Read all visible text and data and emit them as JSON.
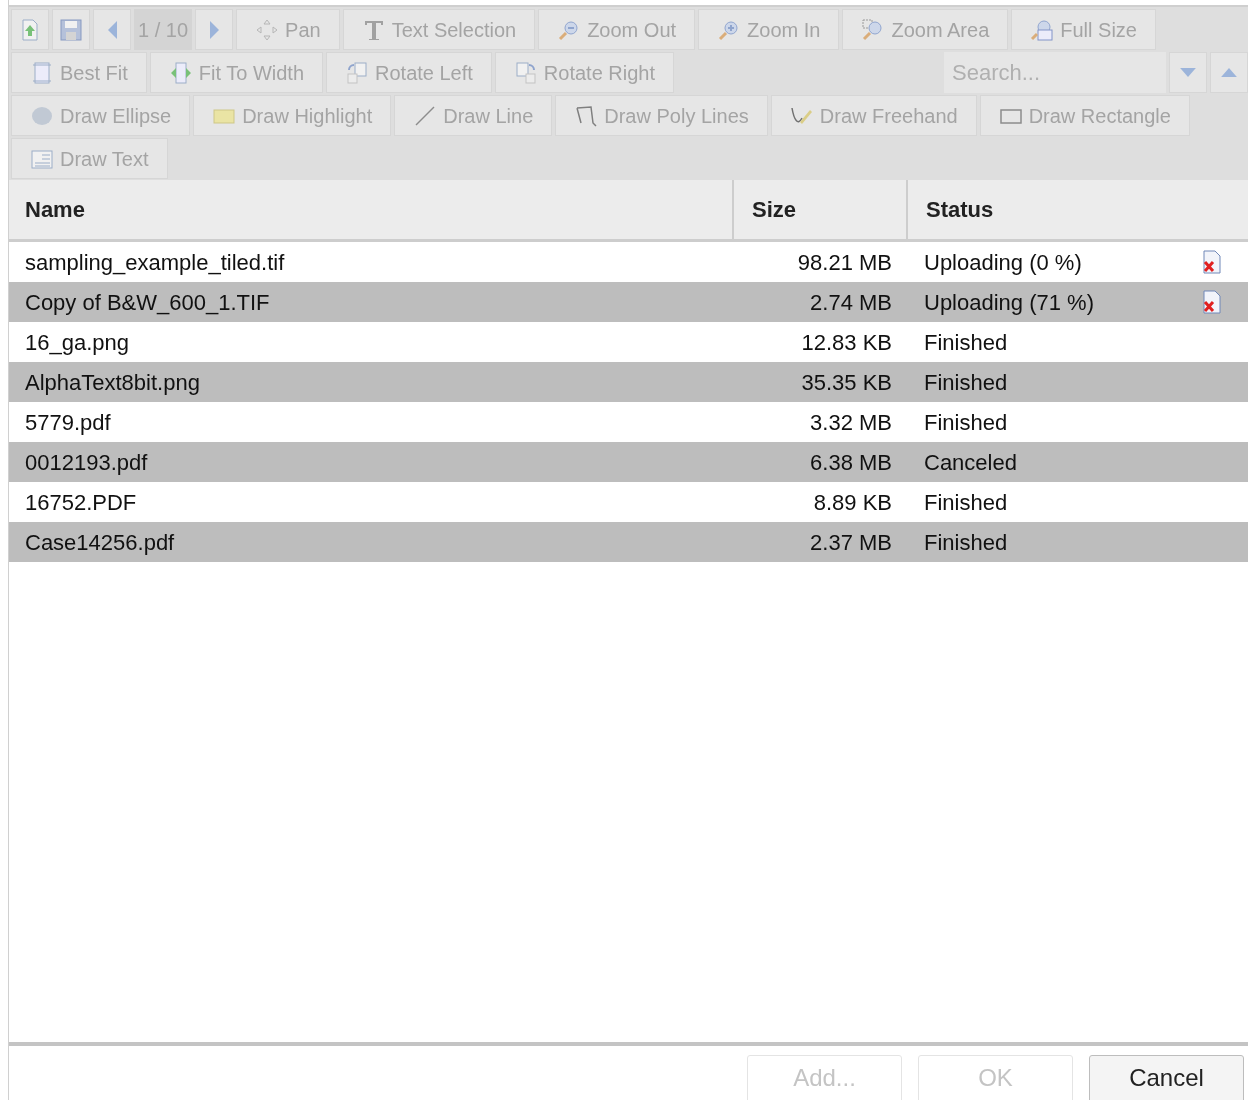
{
  "toolbar": {
    "rows": [
      {
        "buttons": [
          {
            "kind": "upload",
            "disabled": true
          },
          {
            "kind": "save",
            "disabled": true
          },
          {
            "kind": "prev",
            "disabled": true
          },
          {
            "kind": "page",
            "label": "1 / 10",
            "disabled": true
          },
          {
            "kind": "next",
            "disabled": true
          },
          {
            "kind": "pan",
            "label": "Pan",
            "disabled": true
          },
          {
            "kind": "text",
            "label": "Text Selection",
            "disabled": true
          },
          {
            "kind": "zoom-out",
            "label": "Zoom Out",
            "disabled": true
          },
          {
            "kind": "zoom-in",
            "label": "Zoom In",
            "disabled": true
          },
          {
            "kind": "zoom-area",
            "label": "Zoom Area",
            "disabled": true
          },
          {
            "kind": "full-size",
            "label": "Full Size",
            "disabled": true
          }
        ]
      },
      {
        "buttons": [
          {
            "kind": "best-fit",
            "label": "Best Fit",
            "disabled": true
          },
          {
            "kind": "fit-width",
            "label": "Fit To Width",
            "disabled": true
          },
          {
            "kind": "rotate-left",
            "label": "Rotate Left",
            "disabled": true
          },
          {
            "kind": "rotate-right",
            "label": "Rotate Right",
            "disabled": true
          },
          {
            "kind": "search",
            "placeholder": "Search...",
            "disabled": true
          },
          {
            "kind": "down",
            "disabled": true
          },
          {
            "kind": "up",
            "disabled": true
          }
        ]
      },
      {
        "buttons": [
          {
            "kind": "ellipse",
            "label": "Draw Ellipse",
            "disabled": true
          },
          {
            "kind": "highlight",
            "label": "Draw Highlight",
            "disabled": true
          },
          {
            "kind": "line",
            "label": "Draw Line",
            "disabled": true
          },
          {
            "kind": "poly",
            "label": "Draw Poly Lines",
            "disabled": true
          },
          {
            "kind": "freehand",
            "label": "Draw Freehand",
            "disabled": true
          },
          {
            "kind": "rectangle",
            "label": "Draw Rectangle",
            "disabled": true
          }
        ]
      },
      {
        "buttons": [
          {
            "kind": "draw-text",
            "label": "Draw Text",
            "disabled": true
          }
        ]
      }
    ]
  },
  "table": {
    "columns": [
      "Name",
      "Size",
      "Status"
    ],
    "rows": [
      {
        "name": "sampling_example_tiled.tif",
        "size": "98.21 MB",
        "status": "Uploading (0 %)",
        "cancelable": true
      },
      {
        "name": "Copy of B&W_600_1.TIF",
        "size": "2.74 MB",
        "status": "Uploading (71 %)",
        "cancelable": true
      },
      {
        "name": "16_ga.png",
        "size": "12.83 KB",
        "status": "Finished",
        "cancelable": false
      },
      {
        "name": "AlphaText8bit.png",
        "size": "35.35 KB",
        "status": "Finished",
        "cancelable": false
      },
      {
        "name": "5779.pdf",
        "size": "3.32 MB",
        "status": "Finished",
        "cancelable": false
      },
      {
        "name": "0012193.pdf",
        "size": "6.38 MB",
        "status": "Canceled",
        "cancelable": false
      },
      {
        "name": "16752.PDF",
        "size": "8.89 KB",
        "status": "Finished",
        "cancelable": false
      },
      {
        "name": "Case14256.pdf",
        "size": "2.37 MB",
        "status": "Finished",
        "cancelable": false
      }
    ]
  },
  "buttons": [
    {
      "label": "Add...",
      "disabled": true
    },
    {
      "label": "OK",
      "disabled": true
    },
    {
      "label": "Cancel",
      "disabled": false
    }
  ]
}
